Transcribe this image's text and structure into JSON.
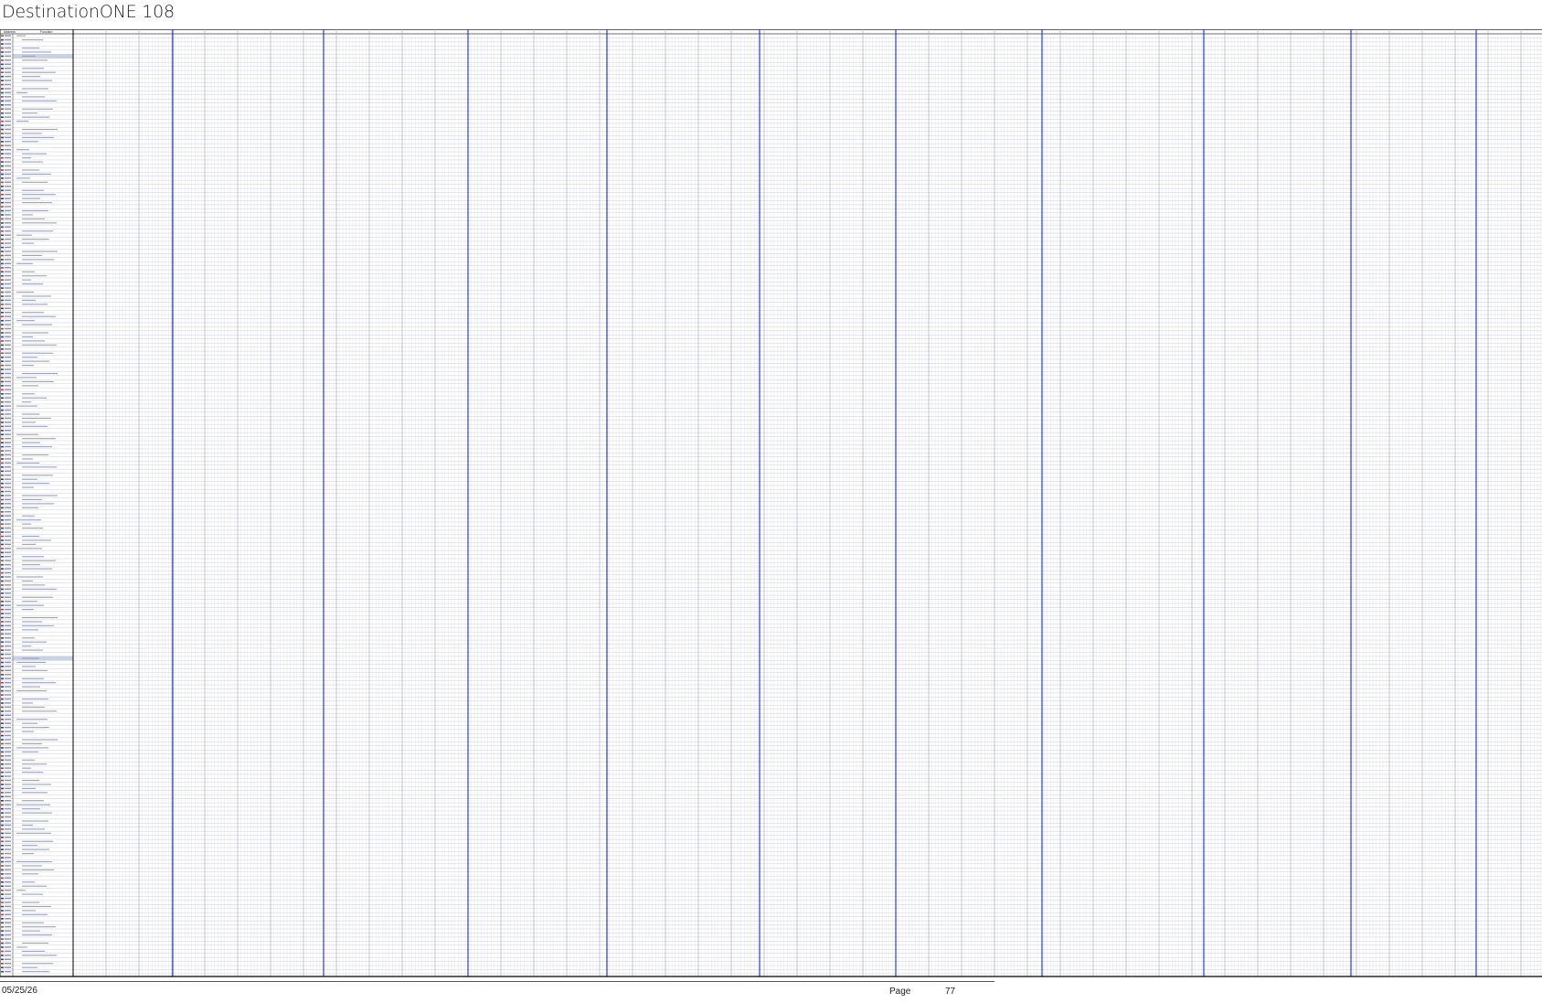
{
  "document": {
    "title": "DestinationONE 108"
  },
  "table": {
    "header": {
      "col1": "Address",
      "col2": "Function"
    }
  },
  "footer": {
    "date": "05/25/26",
    "page_label": "Page",
    "page_number": "77"
  },
  "colors": {
    "grid_line": "#b9bccb",
    "group_divider": "#1f2fb8",
    "header_border": "#000000",
    "highlight_row": "#c9d3e6",
    "left_red_mark": "#c0392b",
    "left_blue_mark": "#2c3e9a"
  }
}
